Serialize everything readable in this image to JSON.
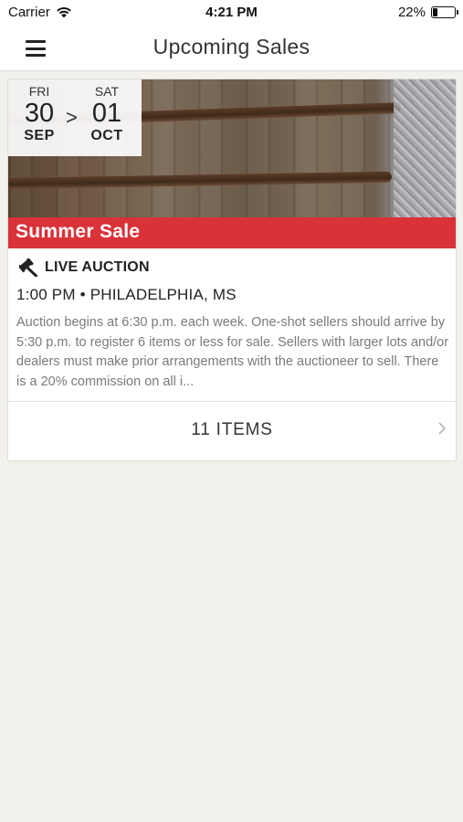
{
  "status_bar": {
    "carrier": "Carrier",
    "time": "4:21 PM",
    "battery_percent": "22%",
    "battery_level": 0.22
  },
  "nav": {
    "title": "Upcoming Sales",
    "menu_icon": "hamburger-menu-icon"
  },
  "sale": {
    "dates": {
      "start": {
        "weekday": "FRI",
        "day": "30",
        "month": "SEP"
      },
      "separator": ">",
      "end": {
        "weekday": "SAT",
        "day": "01",
        "month": "OCT"
      }
    },
    "title": "Summer Sale",
    "type_icon": "gavel-icon",
    "type": "LIVE AUCTION",
    "time_location": "1:00 PM • PHILADELPHIA, MS",
    "description": "Auction begins at 6:30 p.m. each week. One-shot sellers should arrive by 5:30 p.m. to register 6 items or less for sale. Sellers with larger lots and/or dealers must make prior arrangements with the auctioneer to sell. There is a 20% commission on all i...",
    "items_label": "11 ITEMS",
    "accent_color": "#d93238"
  }
}
